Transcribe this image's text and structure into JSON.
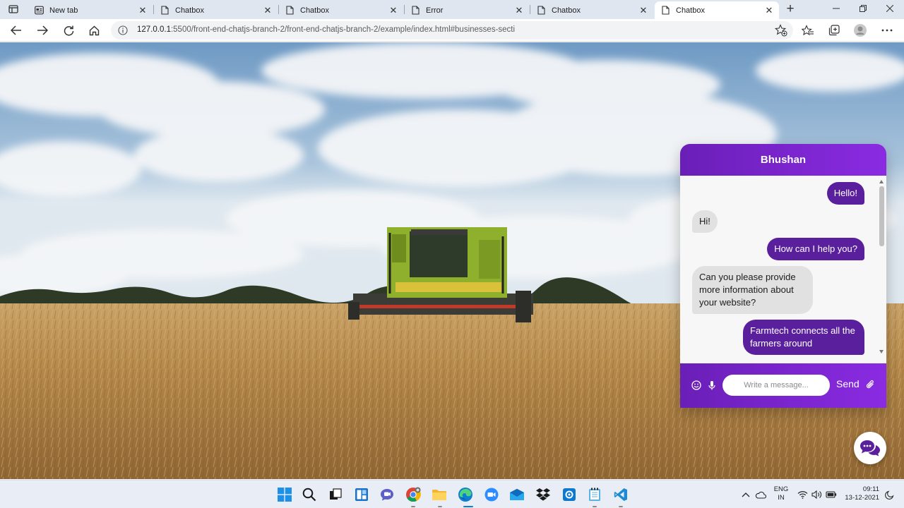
{
  "browser": {
    "tabs": [
      {
        "title": "New tab",
        "icon": "new-tab-icon",
        "active": false
      },
      {
        "title": "Chatbox",
        "icon": "page-icon",
        "active": false
      },
      {
        "title": "Chatbox",
        "icon": "page-icon",
        "active": false
      },
      {
        "title": "Error",
        "icon": "page-icon",
        "active": false
      },
      {
        "title": "Chatbox",
        "icon": "page-icon",
        "active": false
      },
      {
        "title": "Chatbox",
        "icon": "page-icon",
        "active": true
      }
    ],
    "url_host": "127.0.0.1",
    "url_rest": ":5500/front-end-chatjs-branch-2/front-end-chatjs-branch-2/example/index.html#businesses-secti"
  },
  "chat": {
    "header_title": "Bhushan",
    "messages": [
      {
        "from": "out",
        "text": "Hello!"
      },
      {
        "from": "in",
        "text": "Hi!"
      },
      {
        "from": "out",
        "text": "How can I help you?"
      },
      {
        "from": "in",
        "text": "Can you please provide more information about your website?"
      },
      {
        "from": "out",
        "text": "Farmtech connects all the farmers around"
      }
    ],
    "input_placeholder": "Write a message...",
    "send_label": "Send",
    "colors": {
      "header": "#6a1fb7",
      "outgoing": "#5a1f9c",
      "incoming": "#e1e1e1"
    }
  },
  "taskbar": {
    "apps": [
      "windows-start-icon",
      "search-icon",
      "task-view-icon",
      "widgets-icon",
      "teams-chat-icon",
      "chrome-icon",
      "file-explorer-icon",
      "edge-icon",
      "zoom-icon",
      "mail-icon",
      "dropbox-icon",
      "store-icon",
      "notepad-icon",
      "vscode-icon"
    ],
    "lang_top": "ENG",
    "lang_bottom": "IN",
    "time": "09:11",
    "date": "13-12-2021"
  }
}
